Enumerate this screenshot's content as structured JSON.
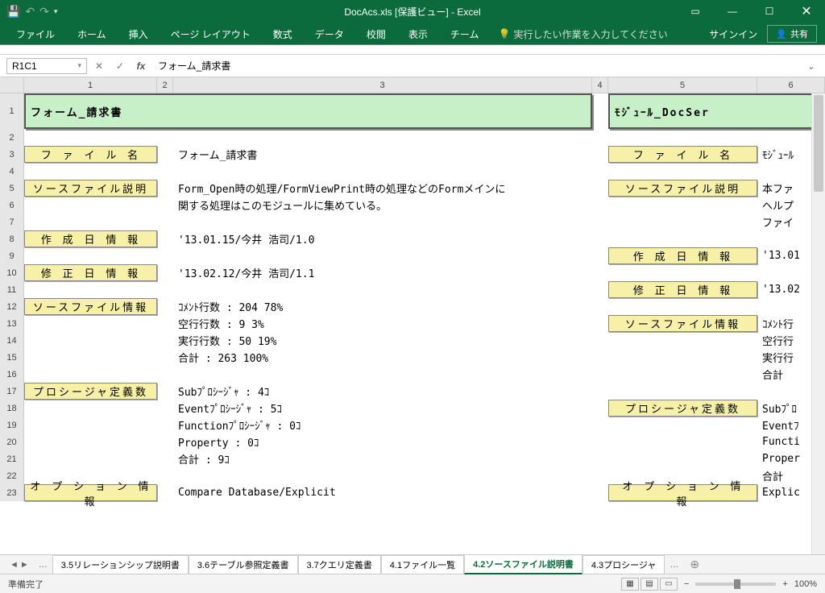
{
  "titlebar": {
    "title": "DocAcs.xls [保護ビュー] - Excel"
  },
  "ribbon": {
    "tabs": [
      "ファイル",
      "ホーム",
      "挿入",
      "ページ レイアウト",
      "数式",
      "データ",
      "校閲",
      "表示",
      "チーム"
    ],
    "tellme": "実行したい作業を入力してください",
    "signin": "サインイン",
    "share": "共有"
  },
  "formula": {
    "namebox": "R1C1",
    "value": "フォーム_請求書"
  },
  "cols": [
    "1",
    "2",
    "3",
    "4",
    "5",
    "6"
  ],
  "rows_labels": [
    "1",
    "2",
    "3",
    "4",
    "5",
    "6",
    "7",
    "8",
    "9",
    "10",
    "11",
    "12",
    "13",
    "14",
    "15",
    "16",
    "17",
    "18",
    "19",
    "20",
    "21",
    "22",
    "23"
  ],
  "left": {
    "title": "フォーム_請求書",
    "labels": {
      "filename": "フ ァ イ ル 名",
      "src_desc": "ソースファイル説明",
      "created": "作 成 日 情 報",
      "modified": "修 正 日 情 報",
      "src_info": "ソースファイル情報",
      "proc_def": "プロシージャ定義数",
      "option": "オ プ シ ョ ン 情 報"
    },
    "values": {
      "filename": "フォーム_請求書",
      "src_desc1": "Form_Open時の処理/FormViewPrint時の処理などのFormメインに",
      "src_desc2": "関する処理はこのモジュールに集めている。",
      "created": "'13.01.15/今井 浩司/1.0",
      "modified": "'13.02.12/今井 浩司/1.1",
      "src_info1": "ｺﾒﾝﾄ行数  :    204    78%",
      "src_info2": "空行行数  :      9     3%",
      "src_info3": "実行行数  :     50    19%",
      "src_info4": "合計      :    263   100%",
      "proc1": "Subﾌﾟﾛｼｰｼﾞｬ       :   4ｺ",
      "proc2": "Eventﾌﾟﾛｼｰｼﾞｬ     :   5ｺ",
      "proc3": "Functionﾌﾟﾛｼｰｼﾞｬ  :   0ｺ",
      "proc4": "Property          :   0ｺ",
      "proc5": "合計              :   9ｺ",
      "option": "Compare Database/Explicit"
    }
  },
  "right": {
    "title": "ﾓｼﾞｭｰﾙ_DocSer",
    "labels": {
      "filename": "フ ァ イ ル 名",
      "src_desc": "ソースファイル説明",
      "created": "作 成 日 情 報",
      "modified": "修 正 日 情 報",
      "src_info": "ソースファイル情報",
      "proc_def": "プロシージャ定義数",
      "option": "オ プ シ ョ ン 情 報"
    },
    "values": {
      "filename": "ﾓｼﾞｭｰﾙ",
      "src_desc1": "本ファ",
      "src_desc2": "ヘルプ",
      "src_desc3": "ファイ",
      "created": "'13.01",
      "modified": "'13.02",
      "src_info1": "ｺﾒﾝﾄ行",
      "src_info2": "空行行",
      "src_info3": "実行行",
      "src_info4": "合計",
      "proc1": "Subﾌﾟﾛ",
      "proc2": "Eventﾌ",
      "proc3": "Functi",
      "proc4": "Proper",
      "proc5": "合計",
      "option": "Explic"
    }
  },
  "sheets": {
    "tabs": [
      "3.5リレーションシップ説明書",
      "3.6テーブル参照定義書",
      "3.7クエリ定義書",
      "4.1ファイル一覧",
      "4.2ソースファイル説明書",
      "4.3プロシージャ"
    ],
    "active": "4.2ソースファイル説明書"
  },
  "status": {
    "left": "準備完了",
    "zoom": "100%"
  }
}
